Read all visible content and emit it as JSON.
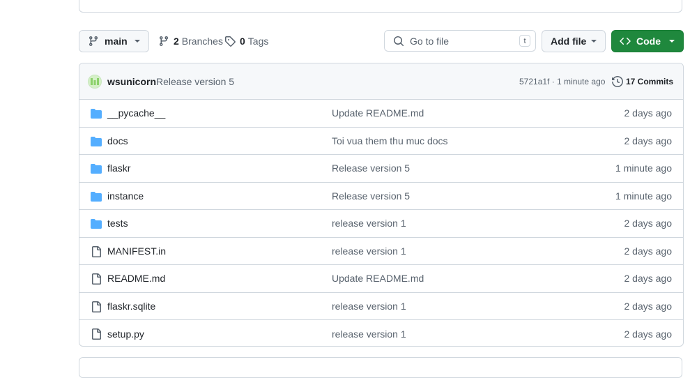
{
  "toolbar": {
    "branch_name": "main",
    "branches_count": "2",
    "branches_label": "Branches",
    "tags_count": "0",
    "tags_label": "Tags",
    "search_placeholder": "Go to file",
    "search_shortcut": "t",
    "add_file_label": "Add file",
    "code_label": "Code"
  },
  "latest_commit": {
    "author": "wsunicorn",
    "message": "Release version 5",
    "sha_time": "5721a1f · 1 minute ago",
    "commits_label": "17 Commits"
  },
  "files": [
    {
      "name": "__pycache__",
      "type": "folder",
      "message": "Update README.md",
      "age": "2 days ago"
    },
    {
      "name": "docs",
      "type": "folder",
      "message": "Toi vua them thu muc docs",
      "age": "2 days ago"
    },
    {
      "name": "flaskr",
      "type": "folder",
      "message": "Release version 5",
      "age": "1 minute ago"
    },
    {
      "name": "instance",
      "type": "folder",
      "message": "Release version 5",
      "age": "1 minute ago"
    },
    {
      "name": "tests",
      "type": "folder",
      "message": "release version 1",
      "age": "2 days ago"
    },
    {
      "name": "MANIFEST.in",
      "type": "file",
      "message": "release version 1",
      "age": "2 days ago"
    },
    {
      "name": "README.md",
      "type": "file",
      "message": "Update README.md",
      "age": "2 days ago"
    },
    {
      "name": "flaskr.sqlite",
      "type": "file",
      "message": "release version 1",
      "age": "2 days ago"
    },
    {
      "name": "setup.py",
      "type": "file",
      "message": "release version 1",
      "age": "2 days ago"
    }
  ],
  "colors": {
    "folder": "#54aeff",
    "file_icon": "#59636e",
    "primary_green": "#1f883d",
    "border": "#d0d7de"
  },
  "icons": {
    "branch": "git-branch-icon",
    "tag": "tag-icon",
    "search": "search-icon",
    "code": "code-icon",
    "history": "history-icon",
    "folder": "folder-icon",
    "file": "file-icon"
  }
}
